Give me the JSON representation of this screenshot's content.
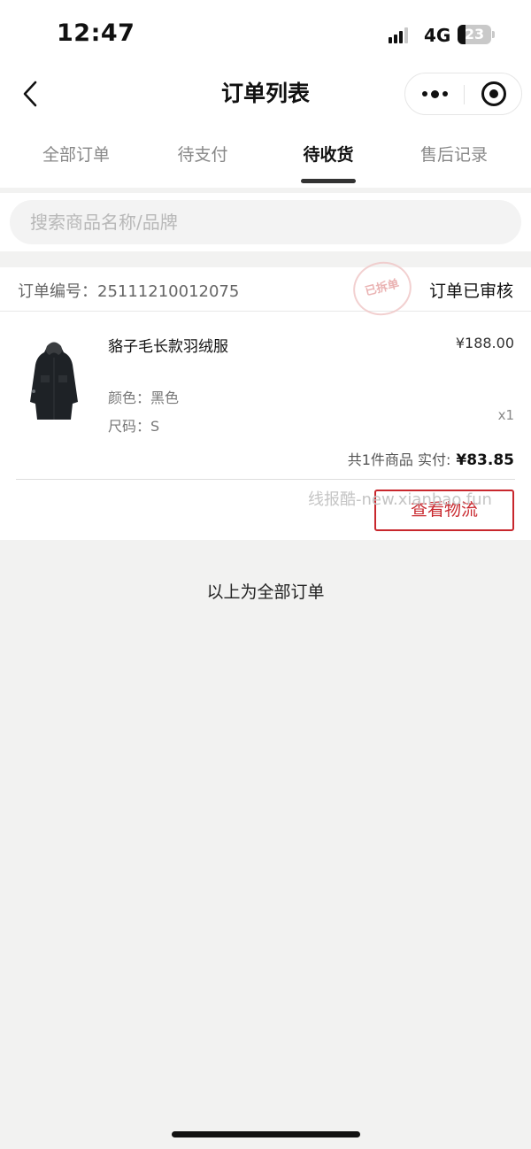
{
  "status_bar": {
    "time": "12:47",
    "network": "4G",
    "battery": "23",
    "battery_level": 0.23
  },
  "nav": {
    "title": "订单列表"
  },
  "tabs": [
    {
      "label": "全部订单"
    },
    {
      "label": "待支付"
    },
    {
      "label": "待收货",
      "active": true
    },
    {
      "label": "售后记录"
    }
  ],
  "search": {
    "placeholder": "搜索商品名称/品牌"
  },
  "order": {
    "number": "订单编号：25111210012075",
    "status": "订单已审核",
    "stamp": "已拆单",
    "item": {
      "name": "貉子毛长款羽绒服",
      "price": "¥188.00",
      "color": "颜色：黑色",
      "size": "尺码：S",
      "quantity": "x1"
    },
    "summary_label": "共1件商品  实付:",
    "paid": "¥83.85",
    "watermark": "线报酷-new.xianbao.fun",
    "logistics_button": "查看物流"
  },
  "footer": {
    "end_text": "以上为全部订单"
  },
  "colors": {
    "accent": "#c8272d",
    "background": "#f2f2f1"
  }
}
